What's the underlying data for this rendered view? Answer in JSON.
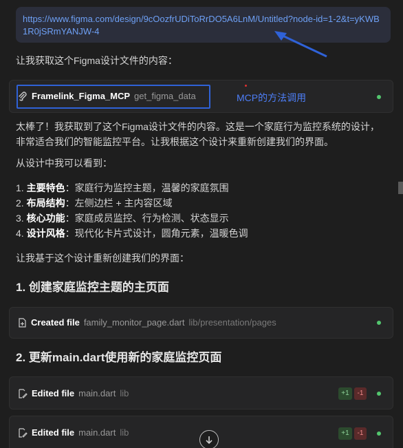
{
  "user_message": {
    "url": "https://www.figma.com/design/9cOozfrUDiToRrDO5A6LnM/Untitled?node-id=1-2&t=yKWB1R0jSRmYANJW-4"
  },
  "intro": "让我获取这个Figma设计文件的内容：",
  "tool_call": {
    "name": "Framelink_Figma_MCP",
    "method": "get_figma_data",
    "annotation": "MCP的方法调用",
    "icon": "mcp-icon"
  },
  "summary": "太棒了！我获取到了这个Figma设计文件的内容。这是一个家庭行为监控系统的设计，非常适合我们的智能监控平台。让我根据这个设计来重新创建我们的界面。",
  "observation_lead": "从设计中我可以看到：",
  "features": [
    {
      "num": "1.",
      "label": "主要特色",
      "text": "：家庭行为监控主题，温馨的家庭氛围"
    },
    {
      "num": "2.",
      "label": "布局结构",
      "text": "：左侧边栏 + 主内容区域"
    },
    {
      "num": "3.",
      "label": "核心功能",
      "text": "：家庭成员监控、行为检测、状态显示"
    },
    {
      "num": "4.",
      "label": "设计风格",
      "text": "：现代化卡片式设计，圆角元素，温暖色调"
    }
  ],
  "rebuild_lead": "让我基于这个设计重新创建我们的界面：",
  "heading1": "1. 创建家庭监控主题的主页面",
  "file1": {
    "action": "Created file",
    "name": "family_monitor_page.dart",
    "path": "lib/presentation/pages"
  },
  "heading2": "2. 更新main.dart使用新的家庭监控页面",
  "file2": {
    "action": "Edited file",
    "name": "main.dart",
    "path": "lib",
    "added": "+1",
    "removed": "-1"
  },
  "file3": {
    "action": "Edited file",
    "name": "main.dart",
    "path": "lib",
    "added": "+1",
    "removed": "-1"
  },
  "colors": {
    "accent": "#2f62d8",
    "status_ok": "#53c66e",
    "link": "#6ea0f5"
  }
}
